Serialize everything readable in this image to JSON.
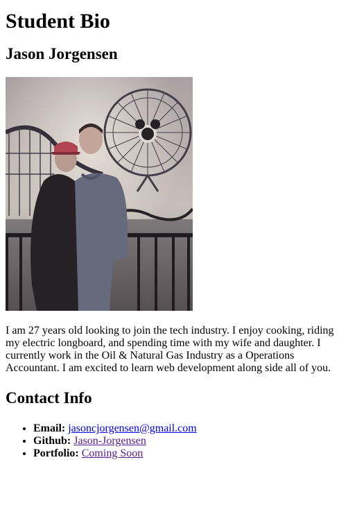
{
  "header": {
    "title": "Student Bio"
  },
  "student": {
    "name": "Jason Jorgensen"
  },
  "photo": {
    "icon": "couple-photo-ferris-wheel"
  },
  "bio": "I am 27 years old looking to join the tech industry. I enjoy cooking, riding my electric longboard, and spending time with my wife and daughter. I currently work in the Oil & Natural Gas Industry as a Operations Accountant. I am excited to learn web development along side all of you.",
  "contact": {
    "title": "Contact Info",
    "email": {
      "label": "Email:",
      "value": "jasoncjorgensen@gmail.com"
    },
    "github": {
      "label": "Github:",
      "value": "Jason-Jorgensen"
    },
    "portfolio": {
      "label": "Portfolio:",
      "value": "Coming Soon"
    }
  },
  "colors": {
    "link": "#0000ee",
    "visited_link": "#551a8b"
  }
}
